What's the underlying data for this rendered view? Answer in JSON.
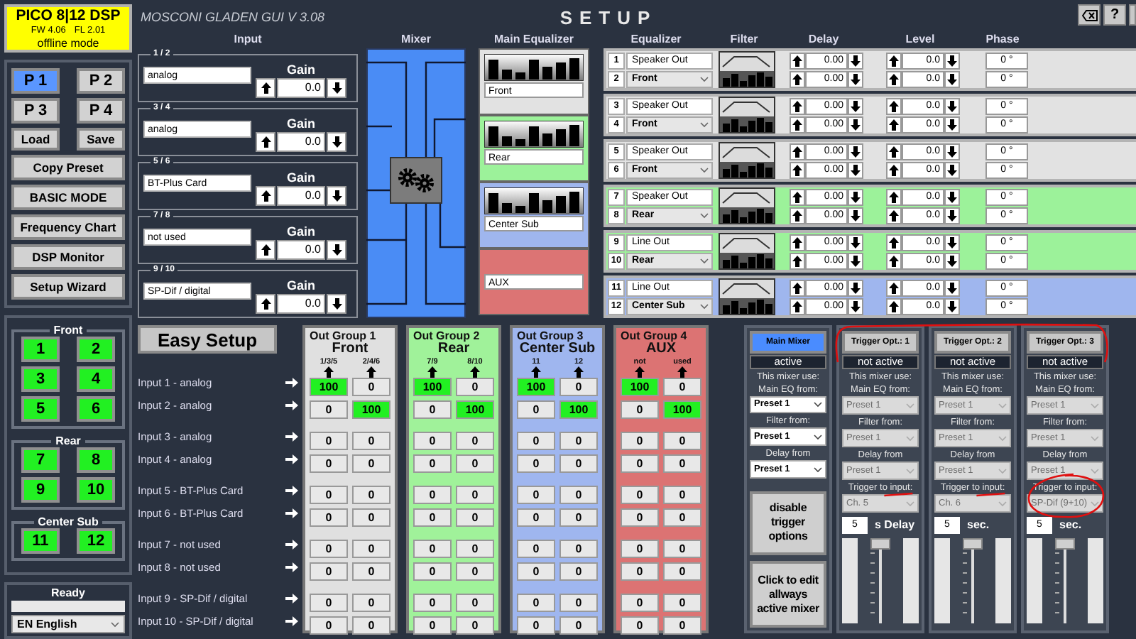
{
  "device": {
    "model": "PICO 8|12 DSP",
    "firmware": "FW 4.06",
    "fl": "FL 2.01",
    "mode": "offline mode"
  },
  "app_title": "MOSCONI GLADEN GUI V 3.08",
  "page_title": "SETUP",
  "window_buttons": [
    {
      "kind": "clear"
    },
    {
      "kind": "help",
      "label": "?"
    },
    {
      "kind": "minimize"
    }
  ],
  "presets": [
    {
      "label": "P 1",
      "selected": true
    },
    {
      "label": "P 2",
      "selected": false
    },
    {
      "label": "P 3",
      "selected": false
    },
    {
      "label": "P 4",
      "selected": false
    }
  ],
  "preset_actions": [
    "Load",
    "Save"
  ],
  "menu_buttons": [
    "Copy Preset",
    "BASIC MODE",
    "Frequency Chart",
    "DSP Monitor",
    "Setup Wizard"
  ],
  "channel_groups": [
    {
      "name": "Front",
      "channels": [
        "1",
        "2",
        "3",
        "4",
        "5",
        "6"
      ]
    },
    {
      "name": "Rear",
      "channels": [
        "7",
        "8",
        "9",
        "10"
      ]
    },
    {
      "name": "Center Sub",
      "channels": [
        "11",
        "12"
      ]
    }
  ],
  "status": {
    "text": "Ready",
    "level": 0
  },
  "language": "EN English",
  "columns": [
    "Input",
    "Mixer",
    "Main Equalizer",
    "Equalizer",
    "Filter",
    "Delay",
    "Level",
    "Phase"
  ],
  "inputs": [
    {
      "pair": "1 / 2",
      "source": "analog",
      "gain_label": "Gain",
      "gain": "0.0"
    },
    {
      "pair": "3 / 4",
      "source": "analog",
      "gain_label": "Gain",
      "gain": "0.0"
    },
    {
      "pair": "5 / 6",
      "source": "BT-Plus Card",
      "gain_label": "Gain",
      "gain": "0.0"
    },
    {
      "pair": "7 / 8",
      "source": "not used",
      "gain_label": "Gain",
      "gain": "0.0"
    },
    {
      "pair": "9 / 10",
      "source": "SP-Dif / digital",
      "gain_label": "Gain",
      "gain": "0.0"
    }
  ],
  "main_eq": [
    {
      "name": "Front",
      "kind": "eq",
      "color": "#e2e2e2"
    },
    {
      "name": "Rear",
      "kind": "eq",
      "color": "#9cf29a"
    },
    {
      "name": "Center Sub",
      "kind": "eq",
      "color": "#9fb6ee"
    },
    {
      "name": "AUX",
      "kind": "plain",
      "color": "#dc7474"
    }
  ],
  "outputs": [
    {
      "color": "#e2e2e2",
      "channels": [
        {
          "number": "1",
          "name": "Speaker Out",
          "kind": "field"
        },
        {
          "number": "2",
          "name": "Front",
          "kind": "select"
        }
      ],
      "delay": [
        "0.00",
        "0.00"
      ],
      "level": [
        "0.0",
        "0.0"
      ],
      "phase": [
        "0 °",
        "0 °"
      ]
    },
    {
      "color": "#e2e2e2",
      "channels": [
        {
          "number": "3",
          "name": "Speaker Out",
          "kind": "field"
        },
        {
          "number": "4",
          "name": "Front",
          "kind": "select"
        }
      ],
      "delay": [
        "0.00",
        "0.00"
      ],
      "level": [
        "0.0",
        "0.0"
      ],
      "phase": [
        "0 °",
        "0 °"
      ]
    },
    {
      "color": "#e2e2e2",
      "channels": [
        {
          "number": "5",
          "name": "Speaker Out",
          "kind": "field"
        },
        {
          "number": "6",
          "name": "Front",
          "kind": "select"
        }
      ],
      "delay": [
        "0.00",
        "0.00"
      ],
      "level": [
        "0.0",
        "0.0"
      ],
      "phase": [
        "0 °",
        "0 °"
      ]
    },
    {
      "color": "#9cf29a",
      "channels": [
        {
          "number": "7",
          "name": "Speaker Out",
          "kind": "field"
        },
        {
          "number": "8",
          "name": "Rear",
          "kind": "select"
        }
      ],
      "delay": [
        "0.00",
        "0.00"
      ],
      "level": [
        "0.0",
        "0.0"
      ],
      "phase": [
        "0 °",
        "0 °"
      ]
    },
    {
      "color": "#9cf29a",
      "channels": [
        {
          "number": "9",
          "name": "Line Out",
          "kind": "field"
        },
        {
          "number": "10",
          "name": "Rear",
          "kind": "select"
        }
      ],
      "delay": [
        "0.00",
        "0.00"
      ],
      "level": [
        "0.0",
        "0.0"
      ],
      "phase": [
        "0 °",
        "0 °"
      ]
    },
    {
      "color": "#9fb6ee",
      "channels": [
        {
          "number": "11",
          "name": "Line Out",
          "kind": "field"
        },
        {
          "number": "12",
          "name": "Center Sub",
          "kind": "select"
        }
      ],
      "delay": [
        "0.00",
        "0.00"
      ],
      "level": [
        "0.0",
        "0.0"
      ],
      "phase": [
        "0 °",
        "0 °"
      ]
    }
  ],
  "easy_setup": "Easy Setup",
  "input_labels": [
    "Input 1 - analog",
    "Input 2 - analog",
    "Input 3 - analog",
    "Input 4 - analog",
    "Input 5 - BT-Plus Card",
    "Input 6 - BT-Plus Card",
    "Input 7 - not used",
    "Input 8 - not used",
    "Input 9 - SP-Dif / digital",
    "Input 10 - SP-Dif / digital"
  ],
  "out_groups": [
    {
      "title": "Out Group 1",
      "name": "Front",
      "color": "#e0e0e0",
      "sub": [
        "1/3/5",
        "2/4/6"
      ],
      "rows": [
        [
          {
            "v": "100",
            "on": true
          },
          {
            "v": "0",
            "on": false
          }
        ],
        [
          {
            "v": "0",
            "on": false
          },
          {
            "v": "100",
            "on": true
          }
        ],
        [
          {
            "v": "0",
            "on": false
          },
          {
            "v": "0",
            "on": false
          }
        ],
        [
          {
            "v": "0",
            "on": false
          },
          {
            "v": "0",
            "on": false
          }
        ],
        [
          {
            "v": "0",
            "on": false
          },
          {
            "v": "0",
            "on": false
          }
        ],
        [
          {
            "v": "0",
            "on": false
          },
          {
            "v": "0",
            "on": false
          }
        ],
        [
          {
            "v": "0",
            "on": false
          },
          {
            "v": "0",
            "on": false
          }
        ],
        [
          {
            "v": "0",
            "on": false
          },
          {
            "v": "0",
            "on": false
          }
        ],
        [
          {
            "v": "0",
            "on": false
          },
          {
            "v": "0",
            "on": false
          }
        ],
        [
          {
            "v": "0",
            "on": false
          },
          {
            "v": "0",
            "on": false
          }
        ]
      ]
    },
    {
      "title": "Out Group 2",
      "name": "Rear",
      "color": "#a0f29a",
      "sub": [
        "7/9",
        "8/10"
      ],
      "rows": [
        [
          {
            "v": "100",
            "on": true
          },
          {
            "v": "0",
            "on": false
          }
        ],
        [
          {
            "v": "0",
            "on": false
          },
          {
            "v": "100",
            "on": true
          }
        ],
        [
          {
            "v": "0",
            "on": false
          },
          {
            "v": "0",
            "on": false
          }
        ],
        [
          {
            "v": "0",
            "on": false
          },
          {
            "v": "0",
            "on": false
          }
        ],
        [
          {
            "v": "0",
            "on": false
          },
          {
            "v": "0",
            "on": false
          }
        ],
        [
          {
            "v": "0",
            "on": false
          },
          {
            "v": "0",
            "on": false
          }
        ],
        [
          {
            "v": "0",
            "on": false
          },
          {
            "v": "0",
            "on": false
          }
        ],
        [
          {
            "v": "0",
            "on": false
          },
          {
            "v": "0",
            "on": false
          }
        ],
        [
          {
            "v": "0",
            "on": false
          },
          {
            "v": "0",
            "on": false
          }
        ],
        [
          {
            "v": "0",
            "on": false
          },
          {
            "v": "0",
            "on": false
          }
        ]
      ]
    },
    {
      "title": "Out Group 3",
      "name": "Center Sub",
      "color": "#9fb6ef",
      "sub": [
        "11",
        "12"
      ],
      "rows": [
        [
          {
            "v": "100",
            "on": true
          },
          {
            "v": "0",
            "on": false
          }
        ],
        [
          {
            "v": "0",
            "on": false
          },
          {
            "v": "100",
            "on": true
          }
        ],
        [
          {
            "v": "0",
            "on": false
          },
          {
            "v": "0",
            "on": false
          }
        ],
        [
          {
            "v": "0",
            "on": false
          },
          {
            "v": "0",
            "on": false
          }
        ],
        [
          {
            "v": "0",
            "on": false
          },
          {
            "v": "0",
            "on": false
          }
        ],
        [
          {
            "v": "0",
            "on": false
          },
          {
            "v": "0",
            "on": false
          }
        ],
        [
          {
            "v": "0",
            "on": false
          },
          {
            "v": "0",
            "on": false
          }
        ],
        [
          {
            "v": "0",
            "on": false
          },
          {
            "v": "0",
            "on": false
          }
        ],
        [
          {
            "v": "0",
            "on": false
          },
          {
            "v": "0",
            "on": false
          }
        ],
        [
          {
            "v": "0",
            "on": false
          },
          {
            "v": "0",
            "on": false
          }
        ]
      ]
    },
    {
      "title": "Out Group 4",
      "name": "AUX",
      "color": "#dc7373",
      "sub": [
        "not",
        "used"
      ],
      "rows": [
        [
          {
            "v": "100",
            "on": true
          },
          {
            "v": "0",
            "on": false
          }
        ],
        [
          {
            "v": "0",
            "on": false
          },
          {
            "v": "100",
            "on": true
          }
        ],
        [
          {
            "v": "0",
            "on": false
          },
          {
            "v": "0",
            "on": false
          }
        ],
        [
          {
            "v": "0",
            "on": false
          },
          {
            "v": "0",
            "on": false
          }
        ],
        [
          {
            "v": "0",
            "on": false
          },
          {
            "v": "0",
            "on": false
          }
        ],
        [
          {
            "v": "0",
            "on": false
          },
          {
            "v": "0",
            "on": false
          }
        ],
        [
          {
            "v": "0",
            "on": false
          },
          {
            "v": "0",
            "on": false
          }
        ],
        [
          {
            "v": "0",
            "on": false
          },
          {
            "v": "0",
            "on": false
          }
        ],
        [
          {
            "v": "0",
            "on": false
          },
          {
            "v": "0",
            "on": false
          }
        ],
        [
          {
            "v": "0",
            "on": false
          },
          {
            "v": "0",
            "on": false
          }
        ]
      ]
    }
  ],
  "mixers": [
    {
      "kind": "main",
      "title": "Main Mixer",
      "selected": true,
      "status": "active",
      "use_label": "This mixer use:",
      "disabled": false,
      "fields": [
        {
          "label": "Main EQ from:",
          "value": "Preset 1"
        },
        {
          "label": "Filter from:",
          "value": "Preset 1"
        },
        {
          "label": "Delay from",
          "value": "Preset 1"
        }
      ],
      "actions": [
        "disable trigger options",
        "Click to edit allways active mixer"
      ]
    },
    {
      "kind": "trigger",
      "title": "Trigger Opt.: 1",
      "selected": false,
      "status": "not active",
      "use_label": "This mixer use:",
      "disabled": true,
      "fields": [
        {
          "label": "Main EQ from:",
          "value": "Preset 1"
        },
        {
          "label": "Filter from:",
          "value": "Preset 1"
        },
        {
          "label": "Delay from",
          "value": "Preset 1"
        }
      ],
      "trigger_label": "Trigger to input:",
      "trigger": "Ch. 5",
      "delay": "5",
      "delay_unit": "s Delay",
      "level": 1
    },
    {
      "kind": "trigger",
      "title": "Trigger Opt.: 2",
      "selected": false,
      "status": "not active",
      "use_label": "This mixer use:",
      "disabled": true,
      "fields": [
        {
          "label": "Main EQ from:",
          "value": "Preset 1"
        },
        {
          "label": "Filter from:",
          "value": "Preset 1"
        },
        {
          "label": "Delay from",
          "value": "Preset 1"
        }
      ],
      "trigger_label": "Trigger to input:",
      "trigger": "Ch. 6",
      "delay": "5",
      "delay_unit": "sec.",
      "level": 1
    },
    {
      "kind": "trigger",
      "title": "Trigger Opt.: 3",
      "selected": false,
      "status": "not active",
      "use_label": "This mixer use:",
      "disabled": true,
      "fields": [
        {
          "label": "Main EQ from:",
          "value": "Preset 1"
        },
        {
          "label": "Filter from:",
          "value": "Preset 1"
        },
        {
          "label": "Delay from",
          "value": "Preset 1"
        }
      ],
      "trigger_label": "Trigger to input:",
      "trigger": "SP-Dif (9+10)",
      "delay": "5",
      "delay_unit": "sec.",
      "level": 1
    }
  ]
}
